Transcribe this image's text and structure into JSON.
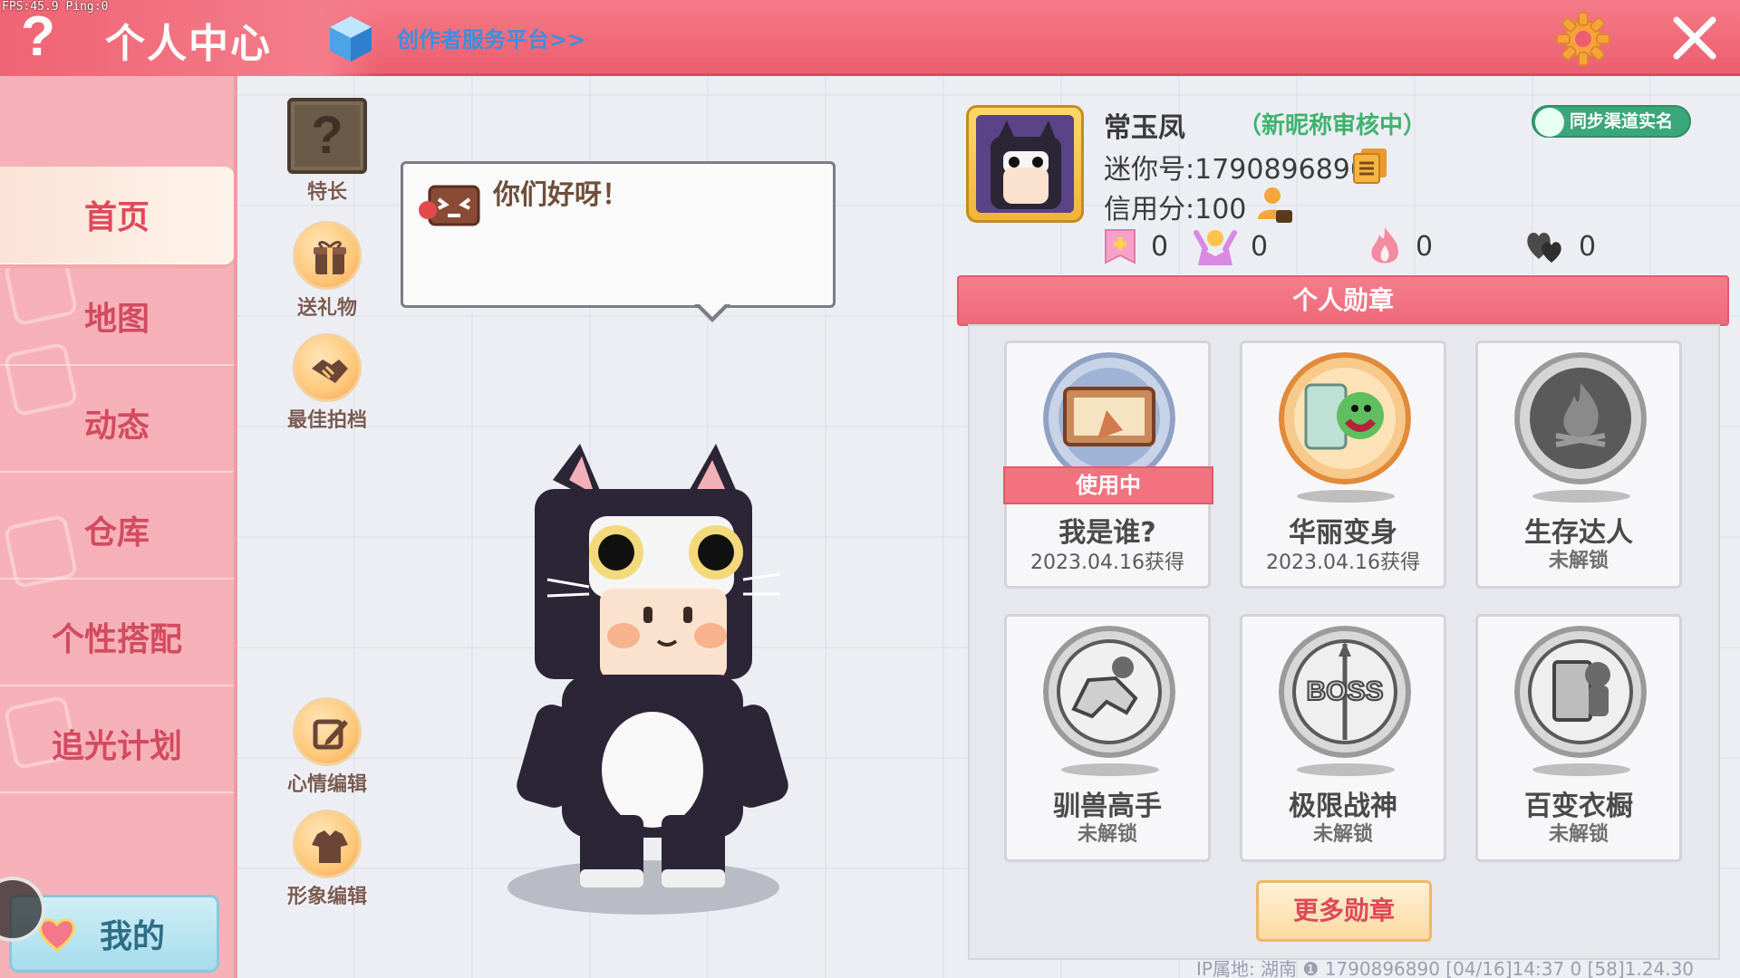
{
  "debug": {
    "fps_text": "FPS:45.9  Ping:0"
  },
  "header": {
    "help_icon": "?",
    "title": "个人中心",
    "creator_link": "创作者服务平台>>",
    "settings_icon": "gear-icon",
    "close_icon": "close-icon"
  },
  "sidebar": {
    "items": [
      {
        "label": "首页",
        "active": true
      },
      {
        "label": "地图",
        "active": false
      },
      {
        "label": "动态",
        "active": false
      },
      {
        "label": "仓库",
        "active": false
      },
      {
        "label": "个性搭配",
        "active": false
      },
      {
        "label": "追光计划",
        "active": false
      }
    ],
    "my_label": "我的"
  },
  "actions": {
    "specialty": "特长",
    "specialty_glyph": "?",
    "gift": "送礼物",
    "best_partner": "最佳拍档",
    "mood_edit": "心情编辑",
    "image_edit": "形象编辑"
  },
  "bubble": {
    "text": "你们好呀！"
  },
  "profile": {
    "nickname": "常玉凤",
    "nickname_status": "（新昵称审核中）",
    "mini_id": "迷你号:1790896890",
    "credit": "信用分:100",
    "sync_button": "同步渠道实名",
    "stats": [
      {
        "icon": "flag-icon",
        "value": "0"
      },
      {
        "icon": "fan-icon",
        "value": "0"
      },
      {
        "icon": "flame-icon",
        "value": "0"
      },
      {
        "icon": "hearts-icon",
        "value": "0"
      }
    ]
  },
  "medals": {
    "header": "个人勋章",
    "items": [
      {
        "name": "我是谁?",
        "sub": "2023.04.16获得",
        "in_use": "使用中"
      },
      {
        "name": "华丽变身",
        "sub": "2023.04.16获得"
      },
      {
        "name": "生存达人",
        "sub": "未解锁"
      },
      {
        "name": "驯兽高手",
        "sub": "未解锁"
      },
      {
        "name": "极限战神",
        "sub": "未解锁",
        "badge_text": "BOSS"
      },
      {
        "name": "百变衣橱",
        "sub": "未解锁"
      }
    ],
    "more_button": "更多勋章"
  },
  "footer": {
    "info": "IP属地: 湖南 ❶  1790896890   [04/16]14:37 0  [58]1.24.30"
  },
  "colors": {
    "accent": "#ec5f70",
    "sidebar": "#f6b1b8",
    "panel": "#e6e8ee"
  }
}
